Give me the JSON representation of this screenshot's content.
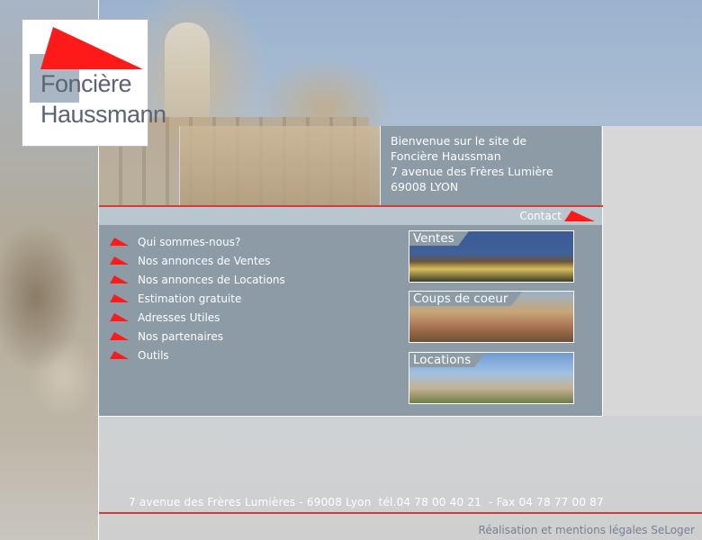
{
  "logo": {
    "line1": "Foncière",
    "line2": "Haussmann",
    "colors": {
      "red": "#ff1a1a",
      "grey_block": "#a9b7c5",
      "text": "#5a6472"
    }
  },
  "welcome": {
    "line1": "Bienvenue sur le site de",
    "line2": "Foncière Haussman",
    "line3": "7 avenue des Frères Lumière",
    "line4": "69008 LYON"
  },
  "contact": {
    "label": "Contact"
  },
  "nav": {
    "items": [
      {
        "label": "Qui sommes-nous?"
      },
      {
        "label": "Nos annonces de Ventes"
      },
      {
        "label": "Nos annonces de Locations"
      },
      {
        "label": "Estimation gratuite"
      },
      {
        "label": "Adresses Utiles"
      },
      {
        "label": "Nos partenaires"
      },
      {
        "label": "Outils"
      }
    ]
  },
  "thumbnails": [
    {
      "label": "Ventes"
    },
    {
      "label": "Coups de coeur"
    },
    {
      "label": "Locations"
    }
  ],
  "footer": {
    "address": "7 avenue des Frères Lumières - 69008 Lyon  tél.04 78 00 40 21  - Fax 04 78 77 00 87",
    "credit": "Réalisation et mentions légales SeLoger"
  },
  "colors": {
    "panel": "#8c9ba6",
    "accent_red": "#ff1a1a",
    "bar": "#b9c6cd",
    "footer_link": "#6f8496"
  }
}
